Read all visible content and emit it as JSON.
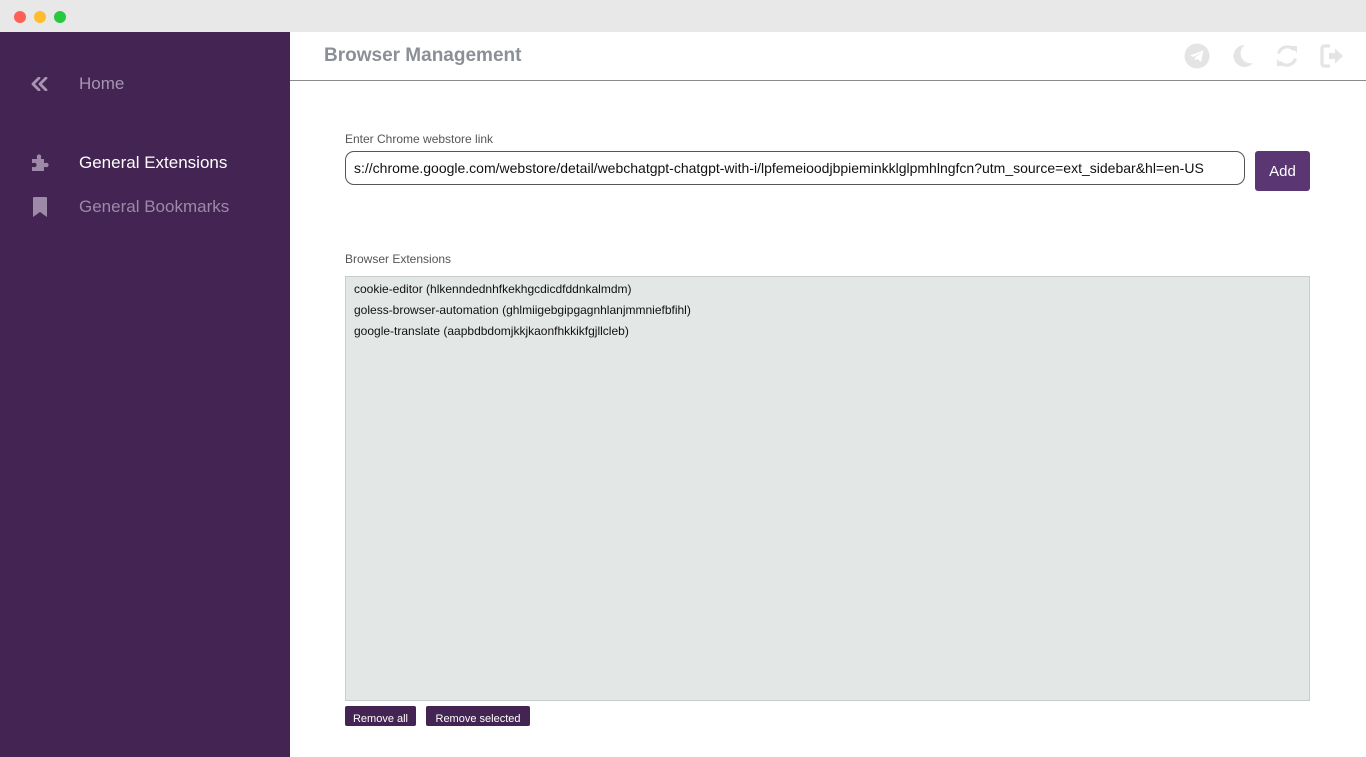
{
  "window": {
    "controls": [
      "close",
      "minimize",
      "maximize"
    ]
  },
  "sidebar": {
    "items": [
      {
        "label": "Home",
        "icon": "double-chevron-left-icon"
      },
      {
        "label": "General Extensions",
        "icon": "puzzle-icon",
        "active": true
      },
      {
        "label": "General Bookmarks",
        "icon": "bookmark-icon"
      }
    ]
  },
  "header": {
    "title": "Browser Management",
    "icons": [
      "telegram-icon",
      "moon-icon",
      "refresh-icon",
      "logout-icon"
    ]
  },
  "form": {
    "link_label": "Enter Chrome webstore link",
    "link_value": "s://chrome.google.com/webstore/detail/webchatgpt-chatgpt-with-i/lpfemeioodjbpieminkklglpmhlngfcn?utm_source=ext_sidebar&hl=en-US",
    "add_label": "Add"
  },
  "extensions": {
    "label": "Browser Extensions",
    "items": [
      "cookie-editor (hlkenndednhfkekhgcdicdfddnkalmdm)",
      "goless-browser-automation (ghlmiigebgipgagnhlanjmmniefbfihl)",
      "google-translate (aapbdbdomjkkjkaonfhkkikfgjllcleb)"
    ]
  },
  "actions": {
    "remove_all": "Remove all",
    "remove_selected": "Remove selected"
  },
  "colors": {
    "sidebar_bg": "#432452",
    "accent": "#5a3672",
    "list_bg": "#e3e7e6"
  }
}
